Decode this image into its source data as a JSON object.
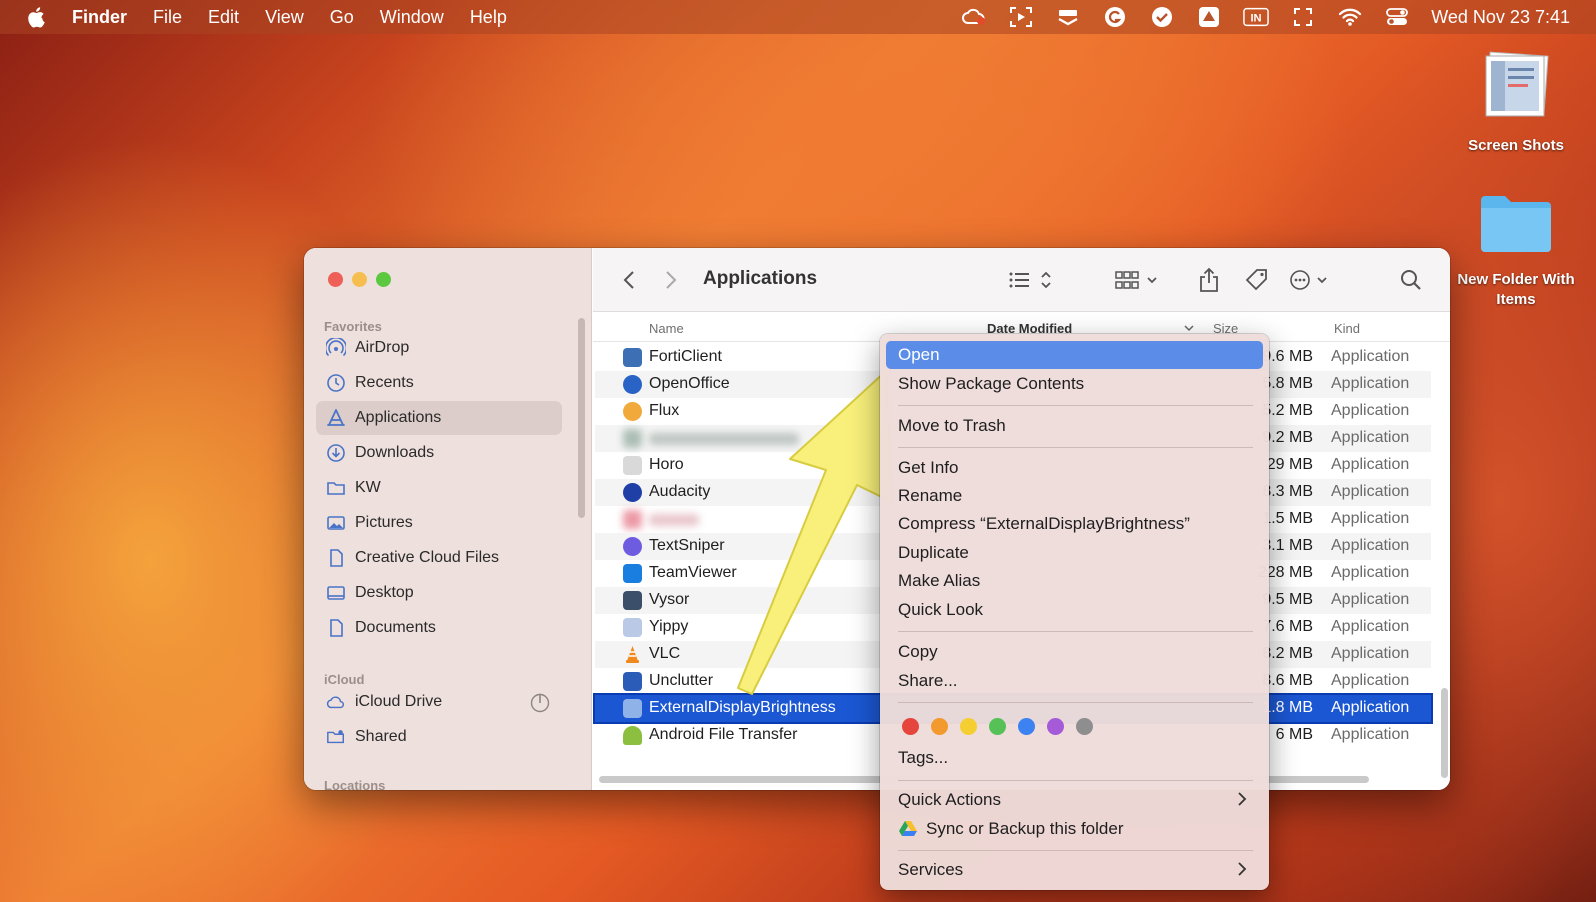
{
  "menubar": {
    "app": "Finder",
    "items": [
      "File",
      "Edit",
      "View",
      "Go",
      "Window",
      "Help"
    ],
    "status_icons": [
      "creative-cloud-icon",
      "screenshot-tool-icon",
      "stack-icon",
      "grammarly-icon",
      "checkmark-icon",
      "drive-icon",
      "input-source-icon",
      "expand-icon",
      "wifi-icon",
      "control-center-icon"
    ],
    "input_label": "IN",
    "clock": "Wed Nov 23  7:41"
  },
  "desktop": {
    "screenshots_label": "Screen Shots",
    "folder_label_line1": "New Folder With",
    "folder_label_line2": "Items"
  },
  "sidebar": {
    "favorites_title": "Favorites",
    "favorites": [
      {
        "label": "AirDrop",
        "icon": "airdrop-icon"
      },
      {
        "label": "Recents",
        "icon": "clock-icon"
      },
      {
        "label": "Applications",
        "icon": "applications-icon",
        "selected": true
      },
      {
        "label": "Downloads",
        "icon": "download-icon"
      },
      {
        "label": "KW",
        "icon": "folder-icon"
      },
      {
        "label": "Pictures",
        "icon": "picture-icon"
      },
      {
        "label": "Creative Cloud Files",
        "icon": "document-icon"
      },
      {
        "label": "Desktop",
        "icon": "desktop-icon"
      },
      {
        "label": "Documents",
        "icon": "document-icon"
      }
    ],
    "icloud_title": "iCloud",
    "icloud": [
      {
        "label": "iCloud Drive",
        "icon": "cloud-icon"
      },
      {
        "label": "Shared",
        "icon": "shared-folder-icon"
      }
    ],
    "locations_title": "Locations"
  },
  "toolbar": {
    "title": "Applications"
  },
  "columns": {
    "name": "Name",
    "date": "Date Modified",
    "size": "Size",
    "kind": "Kind"
  },
  "files": [
    {
      "name": "FortiClient",
      "size": "9.6 MB",
      "kind": "Application",
      "color": "#3d6fb5"
    },
    {
      "name": "OpenOffice",
      "size": "5.8 MB",
      "kind": "Application",
      "color": "#2a63c6"
    },
    {
      "name": "Flux",
      "size": "5.2 MB",
      "kind": "Application",
      "color": "#f2a93b"
    },
    {
      "name": "",
      "size": "9.2 MB",
      "kind": "Application",
      "color": "#7d9a8a",
      "blurred": true
    },
    {
      "name": "Horo",
      "size": "29 MB",
      "kind": "Application",
      "color": "#d9d9d9"
    },
    {
      "name": "Audacity",
      "size": "8.3 MB",
      "kind": "Application",
      "color": "#1f3fa6"
    },
    {
      "name": "",
      "size": "1.5 MB",
      "kind": "Application",
      "color": "#e0556b",
      "blurred": true
    },
    {
      "name": "TextSniper",
      "size": "3.1 MB",
      "kind": "Application",
      "color": "#6d5ce0"
    },
    {
      "name": "TeamViewer",
      "size": "228 MB",
      "kind": "Application",
      "color": "#1a7de0"
    },
    {
      "name": "Vysor",
      "size": "9.5 MB",
      "kind": "Application",
      "color": "#3b4f6b"
    },
    {
      "name": "Yippy",
      "size": "7.6 MB",
      "kind": "Application",
      "color": "#b9c9e6"
    },
    {
      "name": "VLC",
      "size": "8.2 MB",
      "kind": "Application",
      "color": "#f08a1e"
    },
    {
      "name": "Unclutter",
      "size": "8.6 MB",
      "kind": "Application",
      "color": "#2b5db8"
    },
    {
      "name": "ExternalDisplayBrightness",
      "size": "1.8 MB",
      "kind": "Application",
      "color": "#8fb2e8",
      "selected": true
    },
    {
      "name": "Android File Transfer",
      "size": "6 MB",
      "kind": "Application",
      "color": "#8cbf3f"
    }
  ],
  "context_menu": {
    "open": "Open",
    "show_package": "Show Package Contents",
    "move_trash": "Move to Trash",
    "get_info": "Get Info",
    "rename": "Rename",
    "compress": "Compress “ExternalDisplayBrightness”",
    "duplicate": "Duplicate",
    "make_alias": "Make Alias",
    "quick_look": "Quick Look",
    "copy": "Copy",
    "share": "Share...",
    "tag_colors": [
      "#e5453d",
      "#f39a2e",
      "#f5cf32",
      "#55c157",
      "#3c82f0",
      "#a55ad8",
      "#8e8e8e"
    ],
    "tags": "Tags...",
    "quick_actions": "Quick Actions",
    "sync_backup": "Sync or Backup this folder",
    "services": "Services"
  },
  "annotation": {
    "arrow_color": "#f8f07a"
  }
}
